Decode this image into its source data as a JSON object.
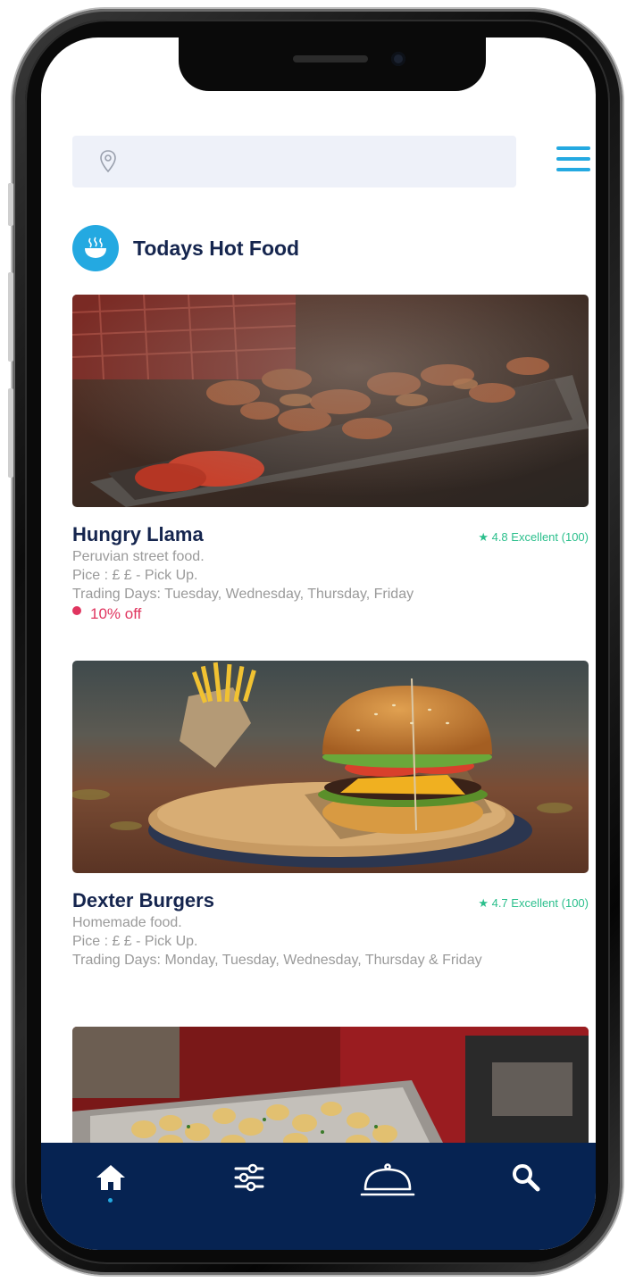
{
  "search": {
    "placeholder": "",
    "value": ""
  },
  "section": {
    "title": "Todays Hot Food"
  },
  "colors": {
    "accent": "#24a9e1",
    "navy": "#062352",
    "rating": "#2bbf8c",
    "offer": "#e0355f"
  },
  "cards": [
    {
      "name": "Hungry Llama",
      "rating": "4.8 Excellent (100)",
      "description": "Peruvian street food.",
      "price": "Pice : £ £ - Pick Up.",
      "trading_days": "Trading Days: Tuesday, Wednesday, Thursday, Friday",
      "offer": "10% off",
      "image_icon": "grilled-meat-photo"
    },
    {
      "name": "Dexter Burgers",
      "rating": "4.7 Excellent (100)",
      "description": "Homemade food.",
      "price": "Pice : £ £ - Pick Up.",
      "trading_days": "Trading Days:  Monday, Tuesday, Wednesday, Thursday & Friday",
      "image_icon": "burger-photo"
    },
    {
      "image_icon": "potatoes-buffet-photo"
    }
  ],
  "nav": [
    {
      "icon": "home-icon",
      "active": true
    },
    {
      "icon": "filter-sliders-icon",
      "active": false
    },
    {
      "icon": "food-cloche-icon",
      "active": false
    },
    {
      "icon": "search-icon",
      "active": false
    }
  ]
}
